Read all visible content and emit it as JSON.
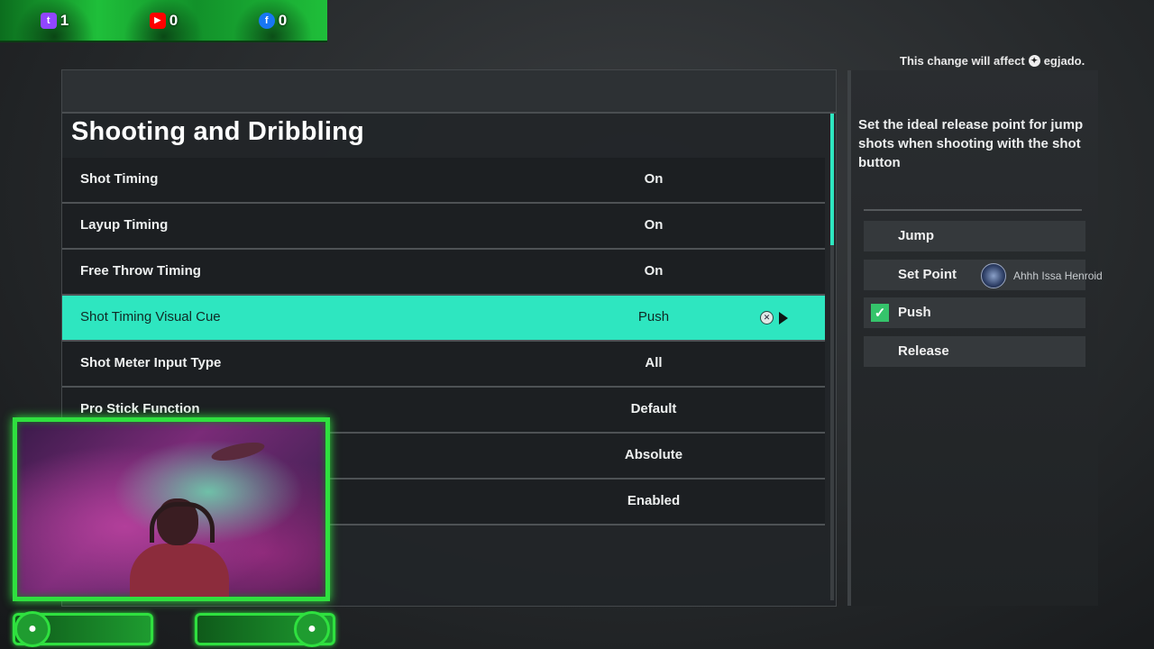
{
  "overlay": {
    "socials": [
      {
        "icon": "twitch-icon",
        "glyph": "t",
        "color": "#9146ff",
        "count": "1"
      },
      {
        "icon": "youtube-icon",
        "glyph": "▶",
        "color": "#ff0000",
        "count": "0"
      },
      {
        "icon": "facebook-icon",
        "glyph": "f",
        "color": "#1877f2",
        "count": "0"
      }
    ]
  },
  "settings": {
    "section_title": "Shooting and Dribbling",
    "rows": [
      {
        "label": "Shot Timing",
        "value": "On"
      },
      {
        "label": "Layup Timing",
        "value": "On"
      },
      {
        "label": "Free Throw Timing",
        "value": "On"
      },
      {
        "label": "Shot Timing Visual Cue",
        "value": "Push"
      },
      {
        "label": "Shot Meter Input Type",
        "value": "All"
      },
      {
        "label": "Pro Stick Function",
        "value": "Default"
      },
      {
        "label": "",
        "value": "Absolute"
      },
      {
        "label": "",
        "value": "Enabled"
      }
    ],
    "selected_index": 3,
    "accent": "#2ee6c0"
  },
  "side": {
    "affect_prefix": "This change will affect",
    "affect_user": "egjado.",
    "description": "Set the ideal release point for jump shots when shooting with the shot button",
    "options": [
      {
        "label": "Jump",
        "checked": false
      },
      {
        "label": "Set Point",
        "checked": false
      },
      {
        "label": "Push",
        "checked": true
      },
      {
        "label": "Release",
        "checked": false
      }
    ],
    "player_name": "Ahhh Issa Henroid"
  }
}
